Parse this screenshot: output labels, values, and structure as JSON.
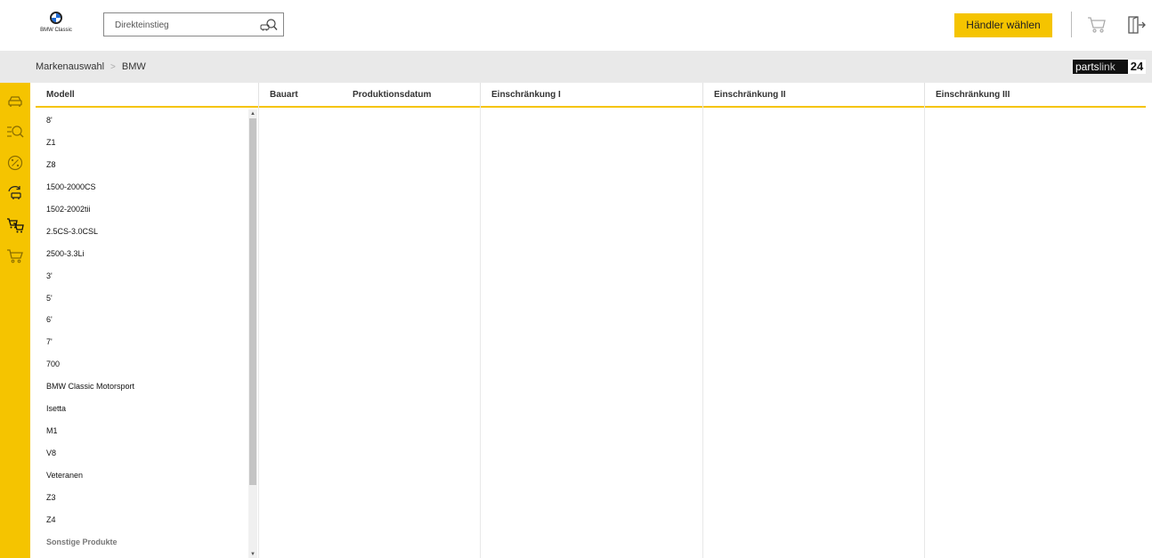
{
  "header": {
    "logo_text": "BMW Classic",
    "search": {
      "placeholder": "Direkteinstieg",
      "value": ""
    },
    "dealer_button": "Händler wählen"
  },
  "breadcrumb": {
    "items": [
      "Markenauswahl",
      "BMW"
    ],
    "separator": ">"
  },
  "partslink": {
    "part_a": "parts",
    "part_b": "link",
    "part_c": "24"
  },
  "table": {
    "headers": [
      "Modell",
      "Bauart",
      "Produktionsdatum",
      "Einschränkung I",
      "Einschränkung II",
      "Einschränkung III"
    ],
    "models": [
      "8'",
      "Z1",
      "Z8",
      "1500-2000CS",
      "1502-2002tii",
      "2.5CS-3.0CSL",
      "2500-3.3Li",
      "3'",
      "5'",
      "6'",
      "7'",
      "700",
      "BMW Classic Motorsport",
      "Isetta",
      "M1",
      "V8",
      "Veteranen",
      "Z3",
      "Z4",
      "Sonstige Produkte"
    ]
  },
  "sidebar_icons": [
    "car-icon",
    "search-list-icon",
    "percent-icon",
    "refresh-car-icon",
    "compare-carts-icon",
    "cart-icon"
  ],
  "colors": {
    "accent": "#f5c400",
    "crumb_bg": "#e9e9e9"
  }
}
